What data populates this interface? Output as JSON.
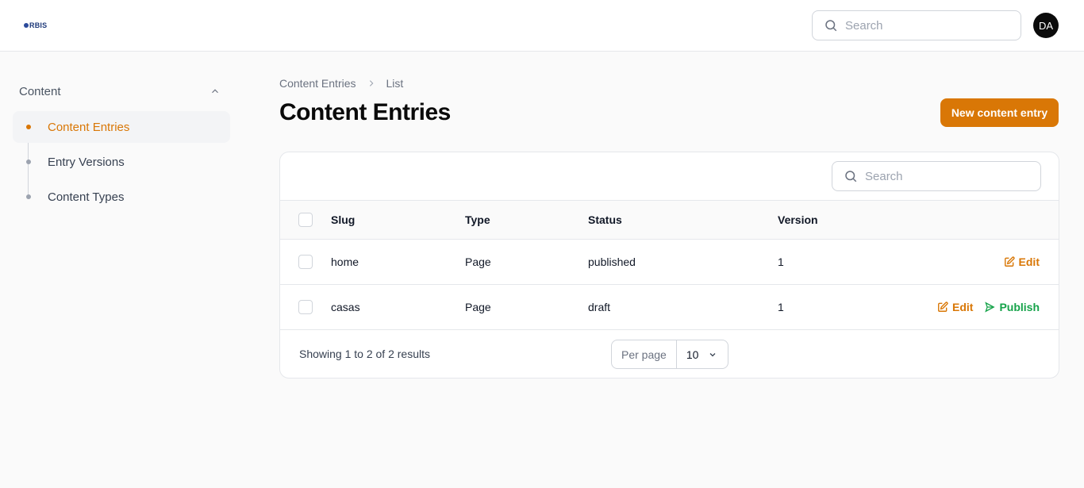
{
  "brand": {
    "logo_text": "RBIS"
  },
  "topbar": {
    "search_placeholder": "Search",
    "avatar_initials": "DA"
  },
  "sidebar": {
    "group_label": "Content",
    "items": [
      {
        "label": "Content Entries",
        "active": true
      },
      {
        "label": "Entry Versions",
        "active": false
      },
      {
        "label": "Content Types",
        "active": false
      }
    ]
  },
  "breadcrumb": {
    "first": "Content Entries",
    "second": "List"
  },
  "page_title": "Content Entries",
  "new_button_label": "New content entry",
  "table": {
    "search_placeholder": "Search",
    "columns": {
      "slug": "Slug",
      "type": "Type",
      "status": "Status",
      "version": "Version"
    },
    "rows": [
      {
        "slug": "home",
        "type": "Page",
        "status": "published",
        "version": "1",
        "edit": "Edit",
        "publish": ""
      },
      {
        "slug": "casas",
        "type": "Page",
        "status": "draft",
        "version": "1",
        "edit": "Edit",
        "publish": "Publish"
      }
    ],
    "footer": {
      "results_text": "Showing 1 to 2 of 2 results",
      "per_page_label": "Per page",
      "per_page_value": "10"
    }
  },
  "colors": {
    "accent": "#d97706",
    "success": "#16a34a",
    "avatar_bg": "#0b0b0b"
  }
}
